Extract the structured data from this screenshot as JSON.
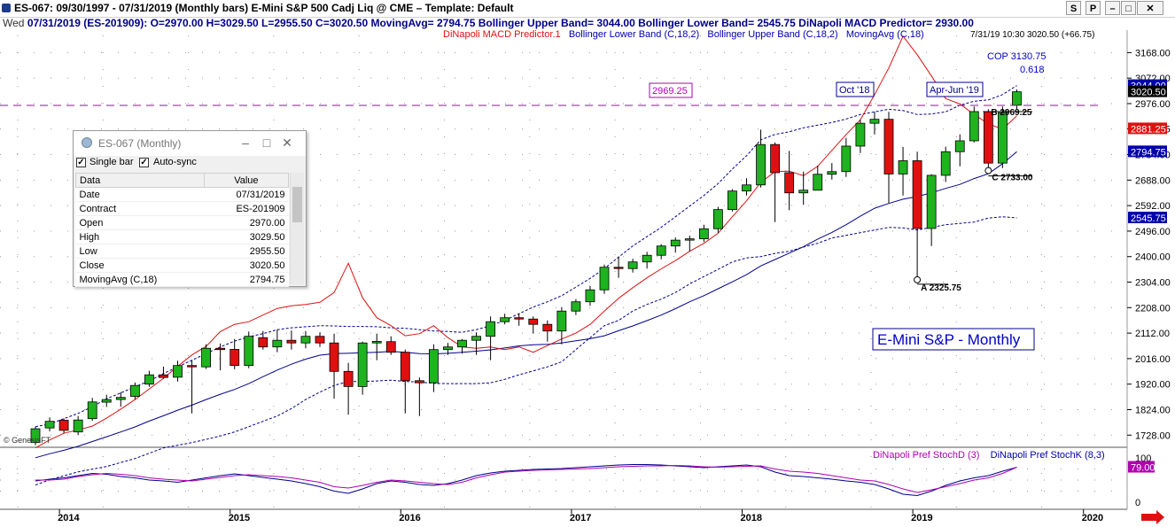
{
  "window": {
    "title": "ES-067:  09/30/1997 - 07/31/2019  (Monthly bars)   E-Mini S&P 500 Cadj Liq @ CME  –  Template: Default",
    "buttons": [
      "S",
      "P",
      "–",
      "□",
      "✕"
    ]
  },
  "infobar": {
    "weekday": "Wed",
    "text": "07/31/2019 (ES-201909):  O=2970.00  H=3029.50  L=2955.50  C=3020.50  MovingAvg= 2794.75  Bollinger Upper Band= 3044.00  Bollinger Lower Band= 2545.75  DiNapoli MACD Predictor= 2930.00"
  },
  "legend": {
    "macd": "DiNapoli MACD Predictor.1",
    "lower": "Bollinger Lower Band (C,18,2)",
    "upper": "Bollinger Upper Band (C,18,2)",
    "ma": "MovingAvg (C,18)",
    "last": "7/31/19 10:30",
    "last_value": "3020.50 (+66.75)",
    "stoch_d": "DiNapoli Pref StochD (3)",
    "stoch_k": "DiNapoli Pref StochK (8,3)"
  },
  "colors": {
    "up": "#1fb31f",
    "down": "#e01010",
    "ma": "#00008b",
    "band": "#00008b",
    "macd": "#e01010",
    "horizontal": "#8b1a8b",
    "stoch_d": "#b000b0",
    "stoch_k": "#00008b"
  },
  "panel": {
    "title": "ES-067 (Monthly)",
    "single_bar": "Single bar",
    "auto_sync": "Auto-sync",
    "header": [
      "Data",
      "Value"
    ],
    "rows": [
      [
        "Date",
        "07/31/2019"
      ],
      [
        "Contract",
        "ES-201909"
      ],
      [
        "Open",
        "2970.00"
      ],
      [
        "High",
        "3029.50"
      ],
      [
        "Low",
        "2955.50"
      ],
      [
        "Close",
        "3020.50"
      ],
      [
        "MovingAvg (C,18)",
        "2794.75"
      ]
    ]
  },
  "annotations": {
    "level_box": "2969.25",
    "oct": "Oct '18",
    "aprjun": "Apr-Jun '19",
    "cop": "COP 3130.75",
    "cop_ratio": "0.618",
    "b": "B 2969.25",
    "c": "C 2733.00",
    "a": "A 2325.75",
    "market_label": "E-Mini S&P - Monthly",
    "copyright": "© GenesisFT"
  },
  "price_axis": {
    "ticks": [
      "3168.00",
      "3072.00",
      "2976.00",
      "2881.25",
      "2784.00",
      "2688.00",
      "2592.00",
      "2496.00",
      "2400.00",
      "2304.00",
      "2208.00",
      "2112.00",
      "2016.00",
      "1920.00",
      "1824.00",
      "1728.00"
    ],
    "tags": [
      {
        "label": "3044.00",
        "value": 3044,
        "bg": "#0000aa"
      },
      {
        "label": "3020.50",
        "value": 3020.5,
        "bg": "#000000"
      },
      {
        "label": "2881.25",
        "value": 2881.25,
        "bg": "#e01010"
      },
      {
        "label": "2794.75",
        "value": 2794.75,
        "bg": "#0000aa"
      },
      {
        "label": "2545.75",
        "value": 2545.75,
        "bg": "#0000aa"
      }
    ],
    "stoch_ticks": [
      "100",
      "0"
    ],
    "stoch_tag": "79.00"
  },
  "time_axis": {
    "labels": [
      "2014",
      "2015",
      "2016",
      "2017",
      "2018",
      "2019",
      "2020"
    ]
  },
  "chart_data": {
    "type": "candlestick",
    "interval": "monthly",
    "start": "2013-11",
    "ylim": [
      1680,
      3230
    ],
    "horizontal_level": 2969.25,
    "candles": [
      [
        1700,
        1760,
        1690,
        1752
      ],
      [
        1755,
        1795,
        1742,
        1780
      ],
      [
        1784,
        1790,
        1735,
        1746
      ],
      [
        1740,
        1800,
        1728,
        1785
      ],
      [
        1790,
        1868,
        1782,
        1853
      ],
      [
        1852,
        1880,
        1834,
        1862
      ],
      [
        1862,
        1890,
        1835,
        1870
      ],
      [
        1874,
        1926,
        1863,
        1915
      ],
      [
        1920,
        1970,
        1910,
        1955
      ],
      [
        1955,
        1986,
        1940,
        1945
      ],
      [
        1946,
        2008,
        1930,
        1990
      ],
      [
        1990,
        2010,
        1810,
        1985
      ],
      [
        1985,
        2070,
        1977,
        2055
      ],
      [
        2055,
        2073,
        1972,
        2051
      ],
      [
        2051,
        2090,
        1976,
        1990
      ],
      [
        1990,
        2118,
        1980,
        2100
      ],
      [
        2095,
        2120,
        2050,
        2060
      ],
      [
        2060,
        2125,
        2040,
        2085
      ],
      [
        2085,
        2122,
        2050,
        2075
      ],
      [
        2075,
        2120,
        2055,
        2100
      ],
      [
        2100,
        2115,
        2060,
        2075
      ],
      [
        2075,
        2110,
        1865,
        1968
      ],
      [
        1968,
        2000,
        1805,
        1911
      ],
      [
        1911,
        2080,
        1880,
        2075
      ],
      [
        2075,
        2110,
        2010,
        2081
      ],
      [
        2080,
        2100,
        2030,
        2040
      ],
      [
        2040,
        2050,
        1810,
        1933
      ],
      [
        1933,
        1945,
        1800,
        1925
      ],
      [
        1925,
        2070,
        1890,
        2050
      ],
      [
        2050,
        2075,
        2030,
        2060
      ],
      [
        2060,
        2090,
        2035,
        2085
      ],
      [
        2085,
        2115,
        2030,
        2100
      ],
      [
        2100,
        2175,
        2010,
        2155
      ],
      [
        2155,
        2185,
        2145,
        2170
      ],
      [
        2170,
        2185,
        2140,
        2165
      ],
      [
        2165,
        2175,
        2110,
        2145
      ],
      [
        2145,
        2160,
        2080,
        2120
      ],
      [
        2120,
        2210,
        2070,
        2195
      ],
      [
        2195,
        2240,
        2180,
        2230
      ],
      [
        2230,
        2290,
        2215,
        2275
      ],
      [
        2275,
        2370,
        2260,
        2360
      ],
      [
        2360,
        2400,
        2320,
        2355
      ],
      [
        2355,
        2392,
        2340,
        2380
      ],
      [
        2380,
        2418,
        2355,
        2405
      ],
      [
        2405,
        2447,
        2390,
        2440
      ],
      [
        2440,
        2472,
        2415,
        2462
      ],
      [
        2462,
        2479,
        2420,
        2467
      ],
      [
        2467,
        2520,
        2455,
        2505
      ],
      [
        2505,
        2587,
        2490,
        2577
      ],
      [
        2577,
        2654,
        2570,
        2647
      ],
      [
        2647,
        2695,
        2630,
        2670
      ],
      [
        2670,
        2878,
        2660,
        2822
      ],
      [
        2822,
        2830,
        2530,
        2716
      ],
      [
        2716,
        2798,
        2575,
        2640
      ],
      [
        2640,
        2720,
        2595,
        2650
      ],
      [
        2650,
        2743,
        2660,
        2710
      ],
      [
        2710,
        2752,
        2690,
        2720
      ],
      [
        2720,
        2847,
        2700,
        2816
      ],
      [
        2816,
        2916,
        2790,
        2902
      ],
      [
        2902,
        2945,
        2860,
        2917
      ],
      [
        2917,
        2945,
        2602,
        2711
      ],
      [
        2711,
        2813,
        2630,
        2761
      ],
      [
        2761,
        2795,
        2316,
        2506
      ],
      [
        2506,
        2710,
        2440,
        2706
      ],
      [
        2706,
        2814,
        2681,
        2795
      ],
      [
        2795,
        2860,
        2740,
        2836
      ],
      [
        2836,
        2965,
        2830,
        2946
      ],
      [
        2946,
        2955,
        2727,
        2752
      ],
      [
        2752,
        2965,
        2733,
        2942
      ],
      [
        2970,
        3029.5,
        2955.5,
        3020.5
      ]
    ],
    "moving_avg": [
      1643,
      1658,
      1671,
      1686,
      1704,
      1722,
      1740,
      1759,
      1781,
      1801,
      1822,
      1841,
      1862,
      1882,
      1900,
      1922,
      1948,
      1973,
      1995,
      2014,
      2029,
      2035,
      2036,
      2038,
      2040,
      2043,
      2040,
      2035,
      2034,
      2036,
      2040,
      2044,
      2049,
      2056,
      2064,
      2068,
      2070,
      2075,
      2083,
      2091,
      2102,
      2121,
      2139,
      2159,
      2180,
      2204,
      2230,
      2253,
      2279,
      2305,
      2332,
      2365,
      2389,
      2413,
      2437,
      2466,
      2491,
      2520,
      2552,
      2582,
      2600,
      2616,
      2626,
      2640,
      2657,
      2672,
      2694,
      2712,
      2750,
      2794.75
    ],
    "upper_band": [
      1760,
      1770,
      1790,
      1810,
      1835,
      1865,
      1887,
      1910,
      1932,
      1960,
      1985,
      2010,
      2035,
      2060,
      2082,
      2098,
      2110,
      2125,
      2132,
      2136,
      2140,
      2139,
      2137,
      2137,
      2136,
      2132,
      2130,
      2125,
      2120,
      2118,
      2115,
      2125,
      2140,
      2160,
      2185,
      2210,
      2230,
      2253,
      2285,
      2318,
      2355,
      2398,
      2440,
      2475,
      2510,
      2550,
      2590,
      2630,
      2675,
      2730,
      2780,
      2840,
      2860,
      2870,
      2885,
      2895,
      2905,
      2918,
      2935,
      2945,
      2955,
      2950,
      2935,
      2937,
      2945,
      2970,
      2985,
      2990,
      3010,
      3044
    ],
    "lower_band": [
      1540,
      1560,
      1575,
      1590,
      1600,
      1610,
      1625,
      1640,
      1660,
      1680,
      1690,
      1700,
      1712,
      1725,
      1740,
      1760,
      1780,
      1800,
      1828,
      1862,
      1890,
      1915,
      1930,
      1930,
      1932,
      1935,
      1930,
      1928,
      1923,
      1922,
      1922,
      1922,
      1925,
      1938,
      1955,
      1970,
      1985,
      2004,
      2050,
      2095,
      2140,
      2160,
      2195,
      2220,
      2240,
      2265,
      2297,
      2325,
      2352,
      2380,
      2395,
      2400,
      2412,
      2420,
      2436,
      2450,
      2470,
      2480,
      2490,
      2500,
      2510,
      2508,
      2500,
      2510,
      2520,
      2525,
      2530,
      2545,
      2550,
      2545.75
    ],
    "macd_predictor": [
      1680,
      1710,
      1735,
      1748,
      1762,
      1792,
      1826,
      1862,
      1902,
      1942,
      1987,
      2030,
      2062,
      2118,
      2145,
      2155,
      2180,
      2205,
      2215,
      2220,
      2228,
      2265,
      2375,
      2245,
      2170,
      2140,
      2102,
      2110,
      2140,
      2095,
      2060,
      2055,
      2060,
      2050,
      2060,
      2040,
      2065,
      2090,
      2112,
      2145,
      2195,
      2243,
      2283,
      2320,
      2354,
      2385,
      2420,
      2450,
      2488,
      2550,
      2610,
      2680,
      2720,
      2722,
      2705,
      2740,
      2800,
      2860,
      2915,
      3010,
      3110,
      3230,
      3160,
      3080,
      2995,
      2975,
      2935,
      2900,
      2880,
      2930
    ],
    "stoch_d": [
      50,
      50,
      52,
      58,
      62,
      65,
      63,
      60,
      55,
      52,
      50,
      48,
      52,
      56,
      60,
      62,
      60,
      58,
      55,
      50,
      45,
      35,
      32,
      38,
      45,
      50,
      48,
      45,
      42,
      40,
      45,
      55,
      62,
      68,
      70,
      72,
      73,
      74,
      75,
      76,
      78,
      80,
      81,
      82,
      82,
      83,
      82,
      80,
      79,
      80,
      81,
      82,
      75,
      70,
      68,
      65,
      60,
      55,
      50,
      48,
      40,
      30,
      22,
      28,
      35,
      42,
      50,
      55,
      65,
      79
    ],
    "stoch_k": [
      48,
      52,
      55,
      60,
      65,
      63,
      58,
      55,
      50,
      48,
      45,
      50,
      55,
      60,
      64,
      60,
      56,
      52,
      48,
      42,
      35,
      25,
      20,
      30,
      42,
      48,
      45,
      40,
      38,
      42,
      50,
      60,
      66,
      70,
      72,
      74,
      75,
      76,
      78,
      80,
      82,
      84,
      85,
      85,
      84,
      82,
      80,
      78,
      80,
      82,
      84,
      80,
      68,
      60,
      58,
      55,
      52,
      48,
      45,
      40,
      30,
      18,
      15,
      25,
      38,
      48,
      55,
      60,
      70,
      79
    ]
  }
}
